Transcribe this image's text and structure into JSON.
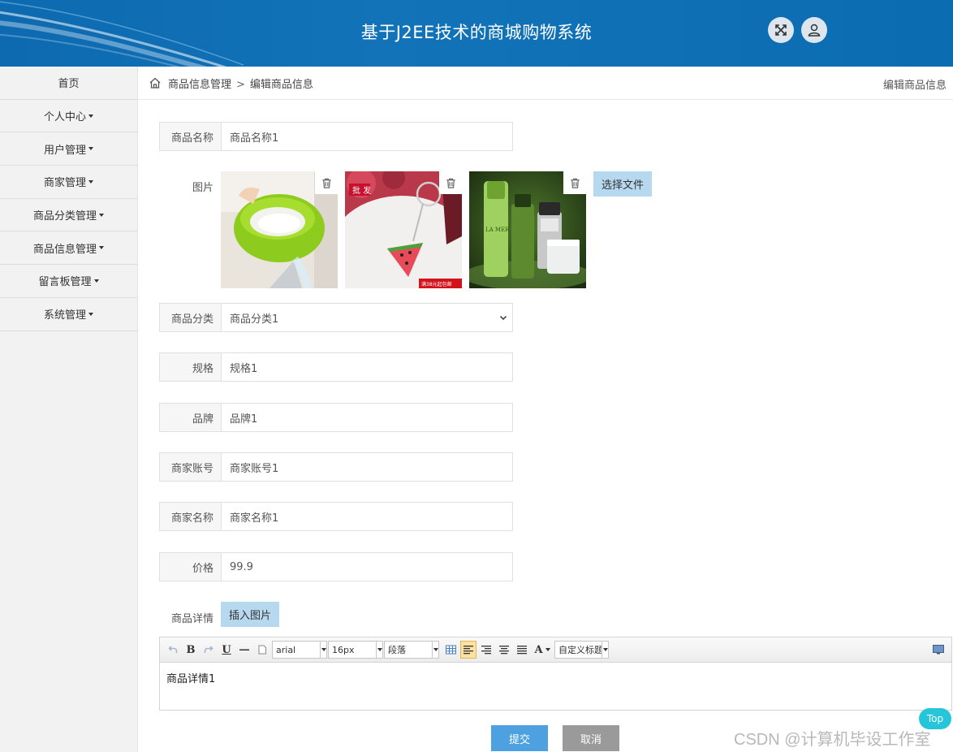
{
  "header": {
    "title": "基于J2EE技术的商城购物系统",
    "icons": [
      "fullscreen-icon",
      "user-icon"
    ]
  },
  "sidebar": {
    "items": [
      {
        "label": "首页",
        "dropdown": false
      },
      {
        "label": "个人中心",
        "dropdown": true
      },
      {
        "label": "用户管理",
        "dropdown": true
      },
      {
        "label": "商家管理",
        "dropdown": true
      },
      {
        "label": "商品分类管理",
        "dropdown": true
      },
      {
        "label": "商品信息管理",
        "dropdown": true
      },
      {
        "label": "留言板管理",
        "dropdown": true
      },
      {
        "label": "系统管理",
        "dropdown": true
      }
    ]
  },
  "breadcrumb": {
    "parent": "商品信息管理",
    "separator": ">",
    "current": "编辑商品信息",
    "right_title": "编辑商品信息"
  },
  "form": {
    "name": {
      "label": "商品名称",
      "value": "商品名称1"
    },
    "images": {
      "label": "图片",
      "choose_button": "选择文件",
      "items": [
        {
          "alt": "green rice-washing colander"
        },
        {
          "alt": "watermelon keychain",
          "badge": "批 发",
          "price_tag": "满38元起包邮"
        },
        {
          "alt": "LA MER skincare bottles",
          "brand": "LA MER"
        }
      ]
    },
    "category": {
      "label": "商品分类",
      "value": "商品分类1"
    },
    "spec": {
      "label": "规格",
      "value": "规格1"
    },
    "brand": {
      "label": "品牌",
      "value": "品牌1"
    },
    "merchant_account": {
      "label": "商家账号",
      "value": "商家账号1"
    },
    "merchant_name": {
      "label": "商家名称",
      "value": "商家名称1"
    },
    "price": {
      "label": "价格",
      "value": "99.9"
    },
    "detail": {
      "label": "商品详情",
      "insert_button": "插入图片",
      "toolbar": {
        "bold": "B",
        "underline": "U",
        "font_family": "arial",
        "font_size": "16px",
        "paragraph": "段落",
        "font_color": "A",
        "custom_title": "自定义标题"
      },
      "content": "商品详情1"
    },
    "submit": "提交",
    "cancel": "取消"
  },
  "top_button": "Top",
  "watermark": "CSDN @计算机毕设工作室"
}
